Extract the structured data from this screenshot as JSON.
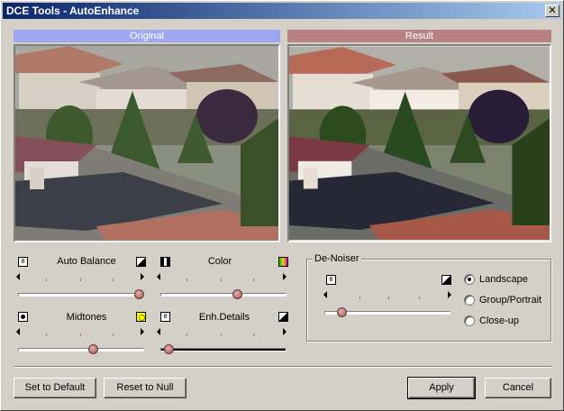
{
  "window": {
    "title": "DCE Tools - AutoEnhance",
    "close_glyph": "✕"
  },
  "panels": {
    "original_label": "Original",
    "result_label": "Result"
  },
  "controls": {
    "auto_balance": {
      "label": "Auto Balance",
      "left_icon_text": "0",
      "value": 0.97
    },
    "color": {
      "label": "Color",
      "value": 0.6
    },
    "midtones": {
      "label": "Midtones",
      "value": 0.58
    },
    "enh_details": {
      "label": "Enh.Details",
      "left_icon_text": "0",
      "value": 0.02
    }
  },
  "denoiser": {
    "label": "De-Noiser",
    "left_icon_text": "0",
    "value": 0.1,
    "options": [
      "Landscape",
      "Group/Portrait",
      "Close-up"
    ],
    "selected": "Landscape"
  },
  "buttons": {
    "set_default": "Set to Default",
    "reset_null": "Reset to Null",
    "apply": "Apply",
    "cancel": "Cancel"
  }
}
